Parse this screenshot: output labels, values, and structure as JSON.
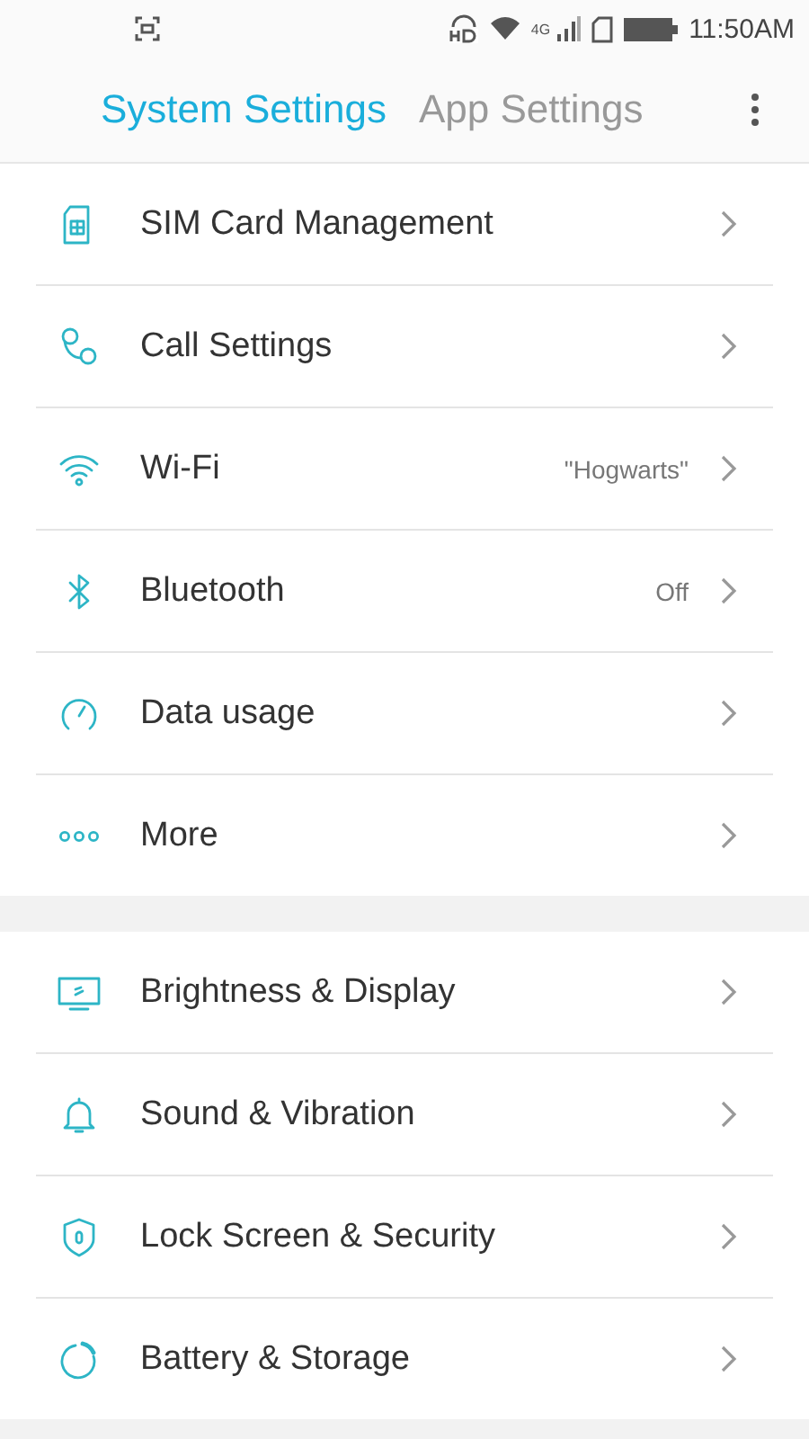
{
  "status_bar": {
    "network": "4G",
    "time": "11:50AM"
  },
  "tabs": [
    {
      "label": "System Settings",
      "selected": true
    },
    {
      "label": "App Settings",
      "selected": false
    }
  ],
  "groups": [
    {
      "items": [
        {
          "label": "SIM Card Management"
        },
        {
          "label": "Call Settings"
        },
        {
          "label": "Wi-Fi",
          "value": "\"Hogwarts\""
        },
        {
          "label": "Bluetooth",
          "value": "Off"
        },
        {
          "label": "Data usage"
        },
        {
          "label": "More"
        }
      ]
    },
    {
      "items": [
        {
          "label": "Brightness & Display"
        },
        {
          "label": "Sound & Vibration"
        },
        {
          "label": "Lock Screen & Security"
        },
        {
          "label": "Battery & Storage"
        }
      ]
    }
  ]
}
